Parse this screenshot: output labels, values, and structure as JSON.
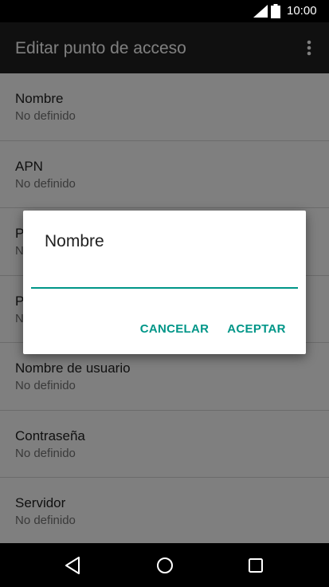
{
  "status_bar": {
    "time": "10:00",
    "icons": [
      "signal-icon",
      "battery-icon"
    ]
  },
  "app_bar": {
    "title": "Editar punto de acceso",
    "overflow_icon": "more-vert-icon"
  },
  "list": {
    "items": [
      {
        "title": "Nombre",
        "summary": "No definido"
      },
      {
        "title": "APN",
        "summary": "No definido"
      },
      {
        "title": "P",
        "summary": "N"
      },
      {
        "title": "P",
        "summary": "N"
      },
      {
        "title": "Nombre de usuario",
        "summary": "No definido"
      },
      {
        "title": "Contraseña",
        "summary": "No definido"
      },
      {
        "title": "Servidor",
        "summary": "No definido"
      }
    ]
  },
  "dialog": {
    "title": "Nombre",
    "input_value": "",
    "cancel_label": "CANCELAR",
    "accept_label": "ACEPTAR"
  },
  "nav_bar": {
    "icons": [
      "back-icon",
      "home-icon",
      "recents-icon"
    ]
  },
  "colors": {
    "accent": "#009688",
    "app_bar": "#212121",
    "status_bar": "#000000",
    "nav_bar": "#000000"
  }
}
